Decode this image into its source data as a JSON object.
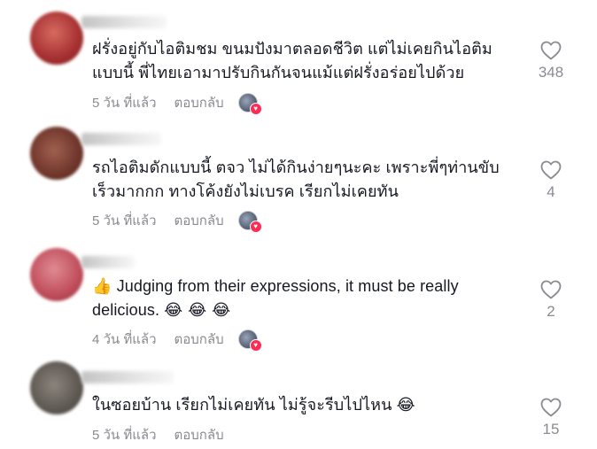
{
  "comments": [
    {
      "lines": [
        "ฝรั่งอยู่กับไอติมชม ขนมปังมาตลอดชีวิต แต่ไม่เคยกินไอติม",
        "แบบนี้ พี่ไทยเอามาปรับกินกันจนแม้แต่ฝรั่งอร่อยไปด้วย"
      ],
      "time": "5 วัน ที่แล้ว",
      "reply": "ตอบกลับ",
      "likes": "348",
      "avatar_color": "#b23a3a"
    },
    {
      "username": "nisahoijai",
      "lines": [
        "รถไอติมดักแบบนี้ ตจว ไม่ได้กินง่ายๆนะคะ เพราะพี่ๆท่านขับ",
        "เร็วมากกก ทางโค้งยังไม่เบรค เรียกไม่เคยทัน"
      ],
      "time": "5 วัน ที่แล้ว",
      "reply": "ตอบกลับ",
      "likes": "4",
      "avatar_color": "#8a4a3c"
    },
    {
      "prefix_emoji": "👍",
      "lines": [
        "Judging from their expressions, it must be really",
        "delicious."
      ],
      "suffix_emoji": "😂 😂 😂",
      "time": "4 วัน ที่แล้ว",
      "reply": "ตอบกลับ",
      "likes": "2",
      "avatar_color": "#c25a66"
    },
    {
      "username": "noohhayooh",
      "lines": [
        "ในซอยบ้าน เรียกไม่เคยทัน ไม่รู้จะรีบไปไหน"
      ],
      "suffix_emoji": "😂",
      "time": "5 วัน ที่แล้ว",
      "reply": "ตอบกลับ",
      "likes": "15",
      "avatar_color": "#6b6660"
    }
  ],
  "icons": {
    "like": "heart-outline-icon",
    "creator_badge": "heart-badge-icon"
  }
}
